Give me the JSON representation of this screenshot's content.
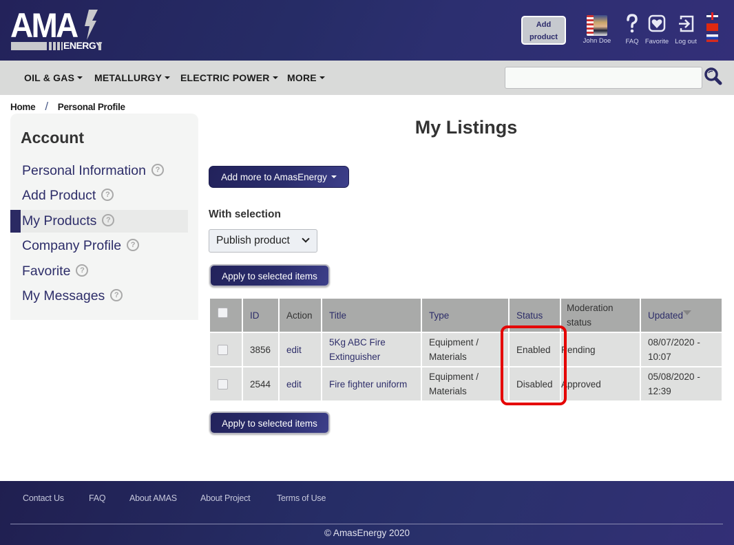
{
  "header": {
    "logo": {
      "main": "AMA",
      "sub": "ENERGY"
    },
    "add_product_label": [
      "Add",
      "product"
    ],
    "user_name": "John Doe",
    "faq_label": "FAQ",
    "favorite_label": "Favorite",
    "logout_label": "Log out",
    "languages": [
      "English",
      "Chinese",
      "Russian"
    ]
  },
  "nav": {
    "items": [
      {
        "label": "OIL & GAS"
      },
      {
        "label": "METALLURGY"
      },
      {
        "label": "ELECTRIC POWER"
      },
      {
        "label": "MORE"
      }
    ],
    "search_value": "",
    "search_placeholder": ""
  },
  "breadcrumb": {
    "home": "Home",
    "separator": "/",
    "current": "Personal Profile"
  },
  "sidebar": {
    "title": "Account",
    "items": [
      {
        "label": "Personal Information",
        "active": false
      },
      {
        "label": "Add Product",
        "active": false
      },
      {
        "label": "My Products",
        "active": true
      },
      {
        "label": "Company Profile",
        "active": false
      },
      {
        "label": "Favorite",
        "active": false
      },
      {
        "label": "My Messages",
        "active": false
      }
    ],
    "help_glyph": "?"
  },
  "main": {
    "title": "My Listings",
    "add_more_label": "Add more to AmasEnergy",
    "with_selection_label": "With selection",
    "selection_value": "Publish product",
    "apply_label": "Apply to selected items",
    "table": {
      "columns": [
        "",
        "ID",
        "Action",
        "Title",
        "Type",
        "Status",
        "Moderation status",
        "Updated"
      ],
      "rows": [
        {
          "id": "3856",
          "action": "edit",
          "title": "5Kg ABC Fire Extinguisher",
          "type": "Equipment / Materials",
          "status": "Enabled",
          "moderation": "Pending",
          "updated": "08/07/2020 - 10:07"
        },
        {
          "id": "2544",
          "action": "edit",
          "title": "Fire fighter uniform",
          "type": "Equipment / Materials",
          "status": "Disabled",
          "moderation": "Approved",
          "updated": "05/08/2020 - 12:39"
        }
      ]
    },
    "highlight_color": "#e50000"
  },
  "footer": {
    "links": [
      "Contact Us",
      "FAQ",
      "About AMAS",
      "About Project",
      "Terms of Use"
    ],
    "copyright": "© AmasEnergy 2020"
  }
}
